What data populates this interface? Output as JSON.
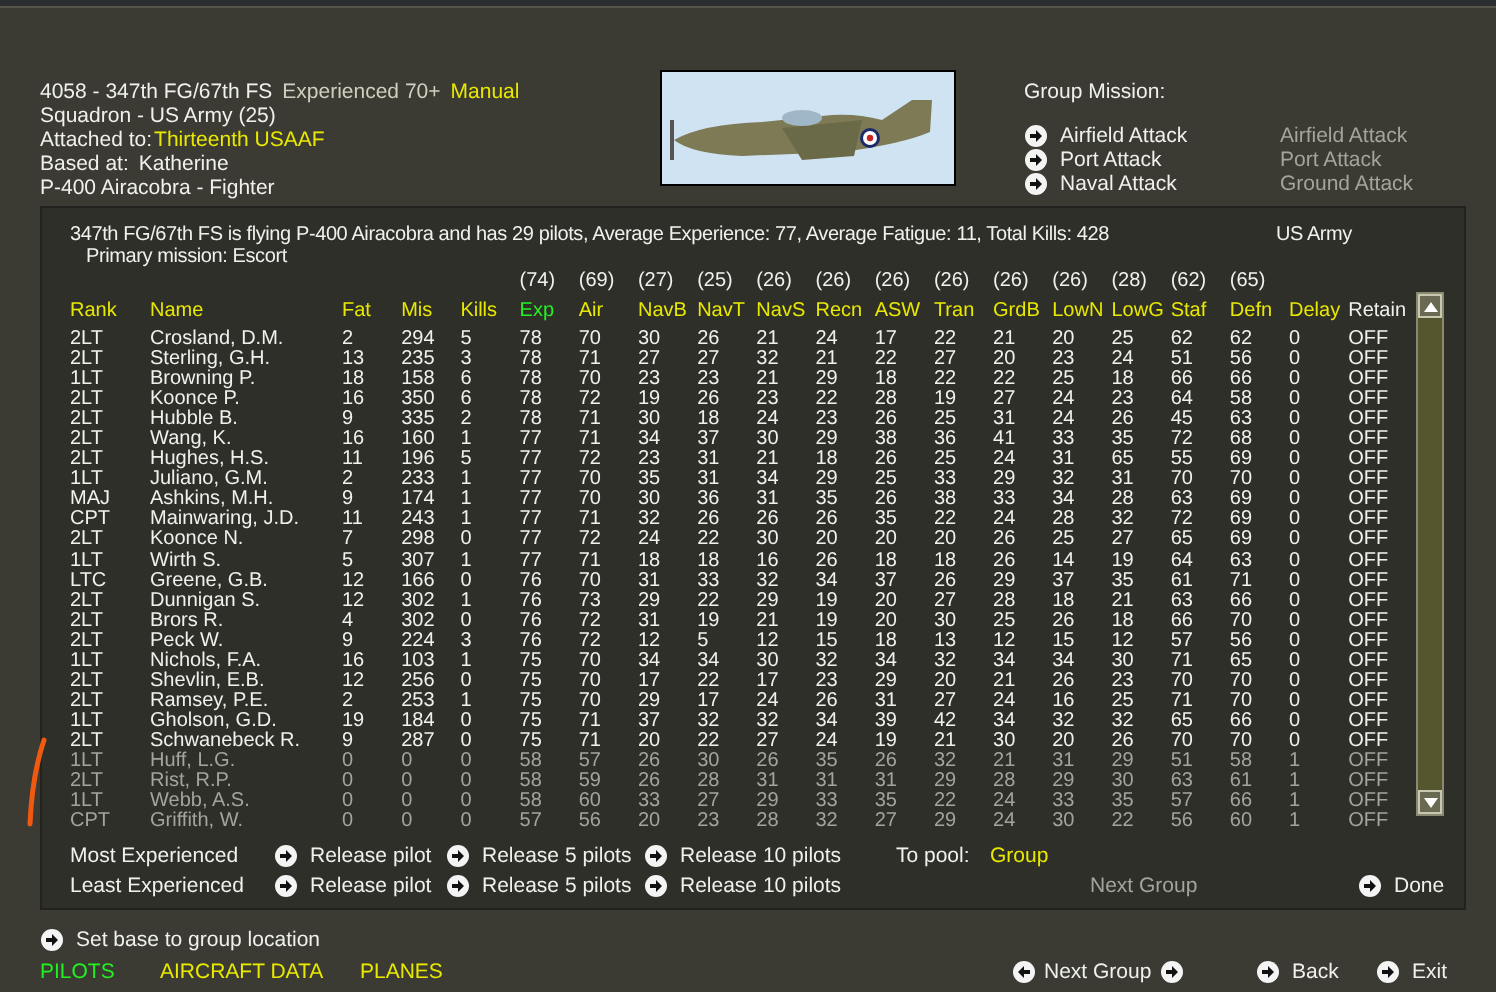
{
  "unit": {
    "title": "4058 - 347th FG/67th FS",
    "experience": "Experienced 70+",
    "mode": "Manual",
    "squadron": "Squadron - US Army (25)",
    "attached_label": "Attached to:",
    "attached_value": "Thirteenth USAAF",
    "based_label": "Based at:",
    "based_value": "Katherine",
    "aircraft": "P-400 Airacobra - Fighter"
  },
  "group_mission": {
    "title": "Group Mission:",
    "options": [
      {
        "label": "Airfield Attack",
        "current": "Airfield Attack"
      },
      {
        "label": "Port Attack",
        "current": "Port Attack"
      },
      {
        "label": "Naval Attack",
        "current": "Ground Attack"
      }
    ]
  },
  "summary": {
    "text": "347th FG/67th FS is flying P-400 Airacobra and has 29 pilots,  Average Experience: 77,  Average Fatigue: 11,  Total Kills: 428",
    "nation": "US Army",
    "primary": "Primary mission: Escort"
  },
  "table": {
    "columns": [
      {
        "label": "Rank",
        "selected": false,
        "sortable": true
      },
      {
        "label": "Name",
        "selected": false,
        "sortable": true
      },
      {
        "label": "Fat",
        "selected": false,
        "sortable": true
      },
      {
        "label": "Mis",
        "selected": false,
        "sortable": true
      },
      {
        "label": "Kills",
        "selected": false,
        "sortable": true
      },
      {
        "label": "Exp",
        "average": "(74)",
        "selected": true,
        "sortable": true
      },
      {
        "label": "Air",
        "average": "(69)",
        "selected": false,
        "sortable": true
      },
      {
        "label": "NavB",
        "average": "(27)",
        "selected": false,
        "sortable": true
      },
      {
        "label": "NavT",
        "average": "(25)",
        "selected": false,
        "sortable": true
      },
      {
        "label": "NavS",
        "average": "(26)",
        "selected": false,
        "sortable": true
      },
      {
        "label": "Recn",
        "average": "(26)",
        "selected": false,
        "sortable": true
      },
      {
        "label": "ASW",
        "average": "(26)",
        "selected": false,
        "sortable": true
      },
      {
        "label": "Tran",
        "average": "(26)",
        "selected": false,
        "sortable": true
      },
      {
        "label": "GrdB",
        "average": "(26)",
        "selected": false,
        "sortable": true
      },
      {
        "label": "LowN",
        "average": "(26)",
        "selected": false,
        "sortable": true
      },
      {
        "label": "LowG",
        "average": "(28)",
        "selected": false,
        "sortable": true
      },
      {
        "label": "Staf",
        "average": "(62)",
        "selected": false,
        "sortable": true
      },
      {
        "label": "Defn",
        "average": "(65)",
        "selected": false,
        "sortable": true
      },
      {
        "label": "Delay",
        "selected": false,
        "sortable": true
      },
      {
        "label": "Retain",
        "selected": false,
        "sortable": false
      }
    ],
    "rows": [
      {
        "dimmed": false,
        "cells": [
          "2LT",
          "Crosland, D.M.",
          "2",
          "294",
          "5",
          "78",
          "70",
          "30",
          "26",
          "21",
          "24",
          "17",
          "22",
          "21",
          "20",
          "25",
          "62",
          "62",
          "0",
          "OFF"
        ]
      },
      {
        "dimmed": false,
        "cells": [
          "2LT",
          "Sterling, G.H.",
          "13",
          "235",
          "3",
          "78",
          "71",
          "27",
          "27",
          "32",
          "21",
          "22",
          "27",
          "20",
          "23",
          "24",
          "51",
          "56",
          "0",
          "OFF"
        ]
      },
      {
        "dimmed": false,
        "cells": [
          "1LT",
          "Browning P.",
          "18",
          "158",
          "6",
          "78",
          "70",
          "23",
          "23",
          "21",
          "29",
          "18",
          "22",
          "22",
          "25",
          "18",
          "66",
          "66",
          "0",
          "OFF"
        ]
      },
      {
        "dimmed": false,
        "cells": [
          "2LT",
          "Koonce P.",
          "16",
          "350",
          "6",
          "78",
          "72",
          "19",
          "26",
          "23",
          "22",
          "28",
          "19",
          "27",
          "24",
          "23",
          "64",
          "58",
          "0",
          "OFF"
        ]
      },
      {
        "dimmed": false,
        "cells": [
          "2LT",
          "Hubble B.",
          "9",
          "335",
          "2",
          "78",
          "71",
          "30",
          "18",
          "24",
          "23",
          "26",
          "25",
          "31",
          "24",
          "26",
          "45",
          "63",
          "0",
          "OFF"
        ]
      },
      {
        "dimmed": false,
        "cells": [
          "2LT",
          "Wang, K.",
          "16",
          "160",
          "1",
          "77",
          "71",
          "34",
          "37",
          "30",
          "29",
          "38",
          "36",
          "41",
          "33",
          "35",
          "72",
          "68",
          "0",
          "OFF"
        ]
      },
      {
        "dimmed": false,
        "cells": [
          "2LT",
          "Hughes, H.S.",
          "11",
          "196",
          "5",
          "77",
          "72",
          "23",
          "31",
          "21",
          "18",
          "26",
          "25",
          "24",
          "31",
          "65",
          "55",
          "69",
          "0",
          "OFF"
        ]
      },
      {
        "dimmed": false,
        "cells": [
          "1LT",
          "Juliano, G.M.",
          "2",
          "233",
          "1",
          "77",
          "70",
          "35",
          "31",
          "34",
          "29",
          "25",
          "33",
          "29",
          "32",
          "31",
          "70",
          "70",
          "0",
          "OFF"
        ]
      },
      {
        "dimmed": false,
        "cells": [
          "MAJ",
          "Ashkins, M.H.",
          "9",
          "174",
          "1",
          "77",
          "70",
          "30",
          "36",
          "31",
          "35",
          "26",
          "38",
          "33",
          "34",
          "28",
          "63",
          "69",
          "0",
          "OFF"
        ]
      },
      {
        "dimmed": false,
        "cells": [
          "CPT",
          "Mainwaring, J.D.",
          "11",
          "243",
          "1",
          "77",
          "71",
          "32",
          "26",
          "26",
          "26",
          "35",
          "22",
          "24",
          "28",
          "32",
          "72",
          "69",
          "0",
          "OFF"
        ]
      },
      {
        "dimmed": false,
        "cells": [
          "2LT",
          "Koonce N.",
          "7",
          "298",
          "0",
          "77",
          "72",
          "24",
          "22",
          "30",
          "20",
          "20",
          "20",
          "26",
          "25",
          "27",
          "65",
          "69",
          "0",
          "OFF"
        ]
      },
      {
        "dimmed": false,
        "cells": [
          "1LT",
          "Wirth S.",
          "5",
          "307",
          "1",
          "77",
          "71",
          "18",
          "18",
          "16",
          "26",
          "18",
          "18",
          "26",
          "14",
          "19",
          "64",
          "63",
          "0",
          "OFF"
        ]
      },
      {
        "dimmed": false,
        "cells": [
          "LTC",
          "Greene, G.B.",
          "12",
          "166",
          "0",
          "76",
          "70",
          "31",
          "33",
          "32",
          "34",
          "37",
          "26",
          "29",
          "37",
          "35",
          "61",
          "71",
          "0",
          "OFF"
        ]
      },
      {
        "dimmed": false,
        "cells": [
          "2LT",
          "Dunnigan S.",
          "12",
          "302",
          "1",
          "76",
          "73",
          "29",
          "22",
          "29",
          "19",
          "20",
          "27",
          "28",
          "18",
          "21",
          "63",
          "66",
          "0",
          "OFF"
        ]
      },
      {
        "dimmed": false,
        "cells": [
          "2LT",
          "Brors R.",
          "4",
          "302",
          "0",
          "76",
          "72",
          "31",
          "19",
          "21",
          "19",
          "20",
          "30",
          "25",
          "26",
          "18",
          "66",
          "70",
          "0",
          "OFF"
        ]
      },
      {
        "dimmed": false,
        "cells": [
          "2LT",
          "Peck W.",
          "9",
          "224",
          "3",
          "76",
          "72",
          "12",
          "5",
          "12",
          "15",
          "18",
          "13",
          "12",
          "15",
          "12",
          "57",
          "56",
          "0",
          "OFF"
        ]
      },
      {
        "dimmed": false,
        "cells": [
          "1LT",
          "Nichols, F.A.",
          "16",
          "103",
          "1",
          "75",
          "70",
          "34",
          "34",
          "30",
          "32",
          "34",
          "32",
          "34",
          "34",
          "30",
          "71",
          "65",
          "0",
          "OFF"
        ]
      },
      {
        "dimmed": false,
        "cells": [
          "2LT",
          "Shevlin, E.B.",
          "12",
          "256",
          "0",
          "75",
          "70",
          "17",
          "22",
          "17",
          "23",
          "29",
          "20",
          "21",
          "26",
          "23",
          "70",
          "70",
          "0",
          "OFF"
        ]
      },
      {
        "dimmed": false,
        "cells": [
          "2LT",
          "Ramsey, P.E.",
          "2",
          "253",
          "1",
          "75",
          "70",
          "29",
          "17",
          "24",
          "26",
          "31",
          "27",
          "24",
          "16",
          "25",
          "71",
          "70",
          "0",
          "OFF"
        ]
      },
      {
        "dimmed": false,
        "cells": [
          "1LT",
          "Gholson, G.D.",
          "19",
          "184",
          "0",
          "75",
          "71",
          "37",
          "32",
          "32",
          "34",
          "39",
          "42",
          "34",
          "32",
          "32",
          "65",
          "66",
          "0",
          "OFF"
        ]
      },
      {
        "dimmed": false,
        "cells": [
          "2LT",
          "Schwanebeck R.",
          "9",
          "287",
          "0",
          "75",
          "71",
          "20",
          "22",
          "27",
          "24",
          "19",
          "21",
          "30",
          "20",
          "26",
          "70",
          "70",
          "0",
          "OFF"
        ]
      },
      {
        "dimmed": true,
        "cells": [
          "1LT",
          "Huff, L.G.",
          "0",
          "0",
          "0",
          "58",
          "57",
          "26",
          "30",
          "26",
          "35",
          "26",
          "32",
          "21",
          "31",
          "29",
          "51",
          "58",
          "1",
          "OFF"
        ]
      },
      {
        "dimmed": true,
        "cells": [
          "2LT",
          "Rist, R.P.",
          "0",
          "0",
          "0",
          "58",
          "59",
          "26",
          "28",
          "31",
          "31",
          "31",
          "29",
          "28",
          "29",
          "30",
          "63",
          "61",
          "1",
          "OFF"
        ]
      },
      {
        "dimmed": true,
        "cells": [
          "1LT",
          "Webb, A.S.",
          "0",
          "0",
          "0",
          "58",
          "60",
          "33",
          "27",
          "29",
          "33",
          "35",
          "22",
          "24",
          "33",
          "35",
          "57",
          "66",
          "1",
          "OFF"
        ]
      },
      {
        "dimmed": true,
        "cells": [
          "CPT",
          "Griffith, W.",
          "0",
          "0",
          "0",
          "57",
          "56",
          "20",
          "23",
          "28",
          "32",
          "27",
          "29",
          "24",
          "30",
          "22",
          "56",
          "60",
          "1",
          "OFF"
        ]
      }
    ]
  },
  "release_rows": [
    {
      "label": "Most Experienced",
      "actions": [
        "Release pilot",
        "Release 5 pilots",
        "Release 10 pilots"
      ]
    },
    {
      "label": "Least Experienced",
      "actions": [
        "Release pilot",
        "Release 5 pilots",
        "Release 10 pilots"
      ]
    }
  ],
  "pool": {
    "label": "To pool:",
    "value": "Group"
  },
  "panel_next": {
    "label": "Next Group",
    "disabled": true
  },
  "done": "Done",
  "set_base": "Set base to group location",
  "tabs": [
    {
      "label": "PILOTS",
      "selected": true
    },
    {
      "label": "AIRCRAFT DATA",
      "selected": false
    },
    {
      "label": "PLANES",
      "selected": false
    }
  ],
  "nav": {
    "next_group": "Next Group",
    "back": "Back",
    "exit": "Exit"
  }
}
